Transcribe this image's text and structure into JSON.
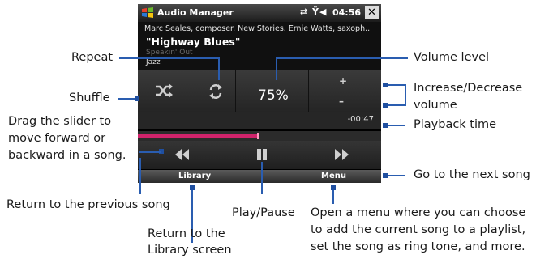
{
  "screen": {
    "app_title": "Audio Manager",
    "status_icons": "⇄ Ÿ◀",
    "time": "04:56",
    "close_glyph": "✕",
    "artist_line": "Marc Seales, composer. New Stories. Ernie Watts, saxoph..",
    "song_title": "\"Highway Blues\"",
    "album": "Speakin' Out",
    "genre": "Jazz",
    "volume": "75%",
    "volume_plus": "+",
    "volume_minus": "–",
    "playback_time": "-00:47",
    "progress_fraction": 0.5,
    "softkey_left": "Library",
    "softkey_right": "Menu",
    "icons": {
      "shuffle": "shuffle-icon",
      "repeat": "repeat-icon",
      "previous": "previous-song-icon",
      "play_pause": "play-pause-icon",
      "next": "next-song-icon"
    }
  },
  "annotations": {
    "repeat": "Repeat",
    "volume_level": "Volume level",
    "shuffle": "Shuffle",
    "increase_decrease_1": "Increase/Decrease",
    "increase_decrease_2": "volume",
    "slider_1": "Drag the slider to",
    "slider_2": "move forward or",
    "slider_3": "backward in a song.",
    "playback_time": "Playback time",
    "next_song": "Go to the next song",
    "previous_song": "Return to the previous song",
    "library_1": "Return to the",
    "library_2": "Library screen",
    "play_pause": "Play/Pause",
    "menu_1": "Open a menu where you can choose",
    "menu_2": "to add the current song to a playlist,",
    "menu_3": "set the song as ring tone, and more."
  },
  "colors": {
    "callout_line": "#2a5db0",
    "progress_fill": "#d0236b"
  }
}
